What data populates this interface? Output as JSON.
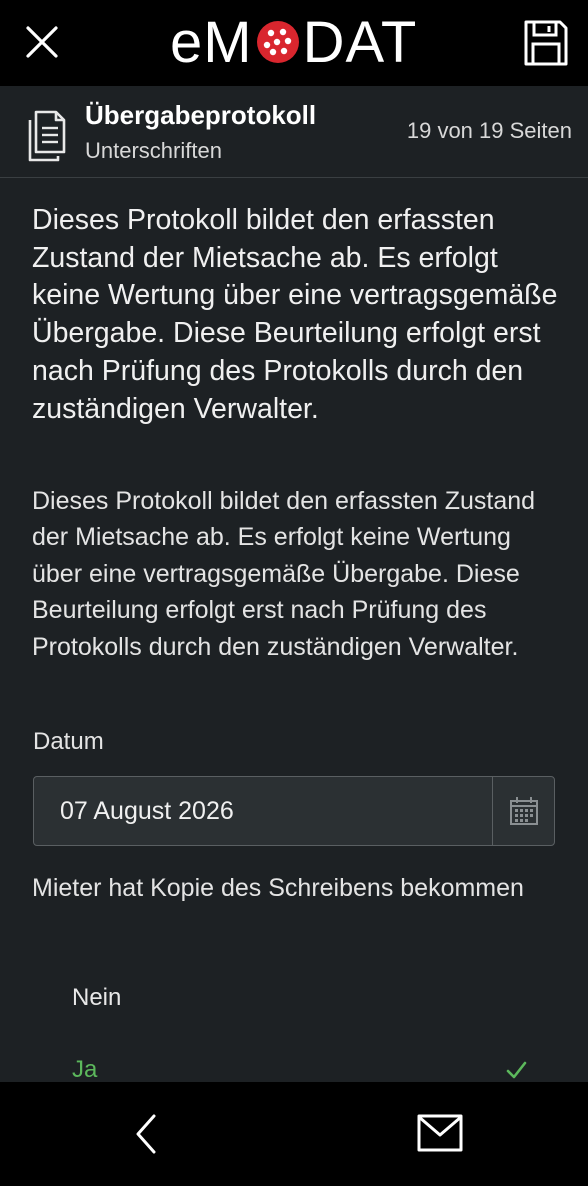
{
  "app": {
    "logo_prefix": "eM",
    "logo_suffix": "DAT",
    "brand_color": "#d9262e"
  },
  "header": {
    "title": "Übergabeprotokoll",
    "subtitle": "Unterschriften",
    "pages": "19 von 19 Seiten"
  },
  "content": {
    "paragraph_1": "Dieses Protokoll bildet den erfassten Zustand der Mietsache ab. Es erfolgt keine Wertung über eine vertragsgemäße Übergabe. Diese Beurteilung erfolgt erst nach Prüfung des Protokolls durch den zuständigen Verwalter.",
    "paragraph_2": "Dieses Protokoll bildet den erfassten Zustand der Mietsache ab. Es erfolgt keine Wertung über eine vertragsgemäße Übergabe. Diese Beurteilung erfolgt erst nach Prüfung des Protokolls durch den zuständigen Verwalter.",
    "date_label": "Datum",
    "date_value": "07 August 2026",
    "copy_question": "Mieter hat Kopie des Schreibens bekommen",
    "options": [
      {
        "label": "Nein",
        "selected": false
      },
      {
        "label": "Ja",
        "selected": true
      }
    ]
  },
  "icons": {
    "close": "close-icon",
    "save": "save-icon",
    "document": "document-icon",
    "calendar": "calendar-icon",
    "check": "check-icon",
    "back": "chevron-left-icon",
    "mail": "mail-icon"
  },
  "colors": {
    "selected_option": "#5cb85c",
    "panel_background": "#1d2124"
  }
}
